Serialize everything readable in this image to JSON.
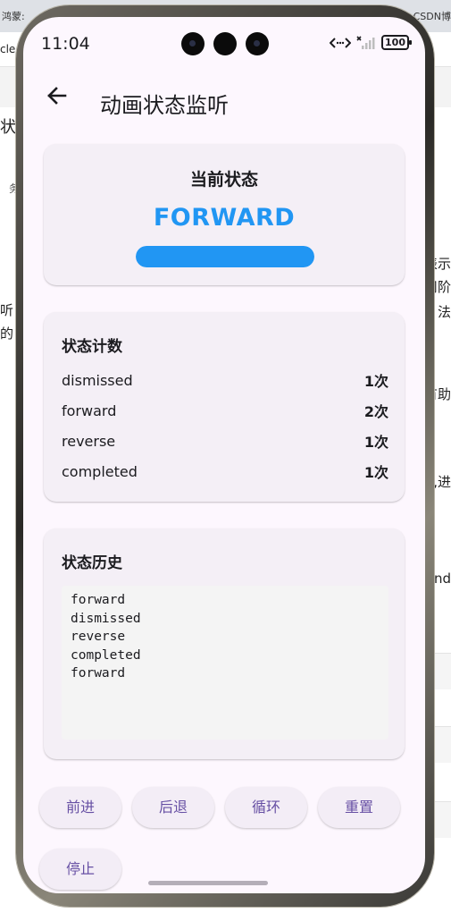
{
  "background_page": {
    "tab_left": "鸿蒙:",
    "tab_right": "CSDN博",
    "left_fragments": [
      "cle",
      "状",
      "务",
      "听",
      "的"
    ],
    "right_fragments": [
      "表示",
      "司阶",
      "法",
      "有助",
      "d),进",
      "und"
    ]
  },
  "status_bar": {
    "time": "11:04",
    "battery": "100"
  },
  "app_bar": {
    "title": "动画状态监听"
  },
  "current_state": {
    "label": "当前状态",
    "value": "FORWARD",
    "progress": 1.0
  },
  "state_counts": {
    "title": "状态计数",
    "rows": [
      {
        "name": "dismissed",
        "count": "1次"
      },
      {
        "name": "forward",
        "count": "2次"
      },
      {
        "name": "reverse",
        "count": "1次"
      },
      {
        "name": "completed",
        "count": "1次"
      }
    ]
  },
  "state_history": {
    "title": "状态历史",
    "lines": [
      "forward",
      "dismissed",
      "reverse",
      "completed",
      "forward"
    ]
  },
  "buttons": {
    "forward": "前进",
    "backward": "后退",
    "loop": "循环",
    "reset": "重置",
    "stop": "停止"
  },
  "colors": {
    "accent": "#2196f3",
    "button_text": "#6750a4",
    "card_bg": "#f4eff6",
    "screen_bg": "#fdf7fe"
  }
}
